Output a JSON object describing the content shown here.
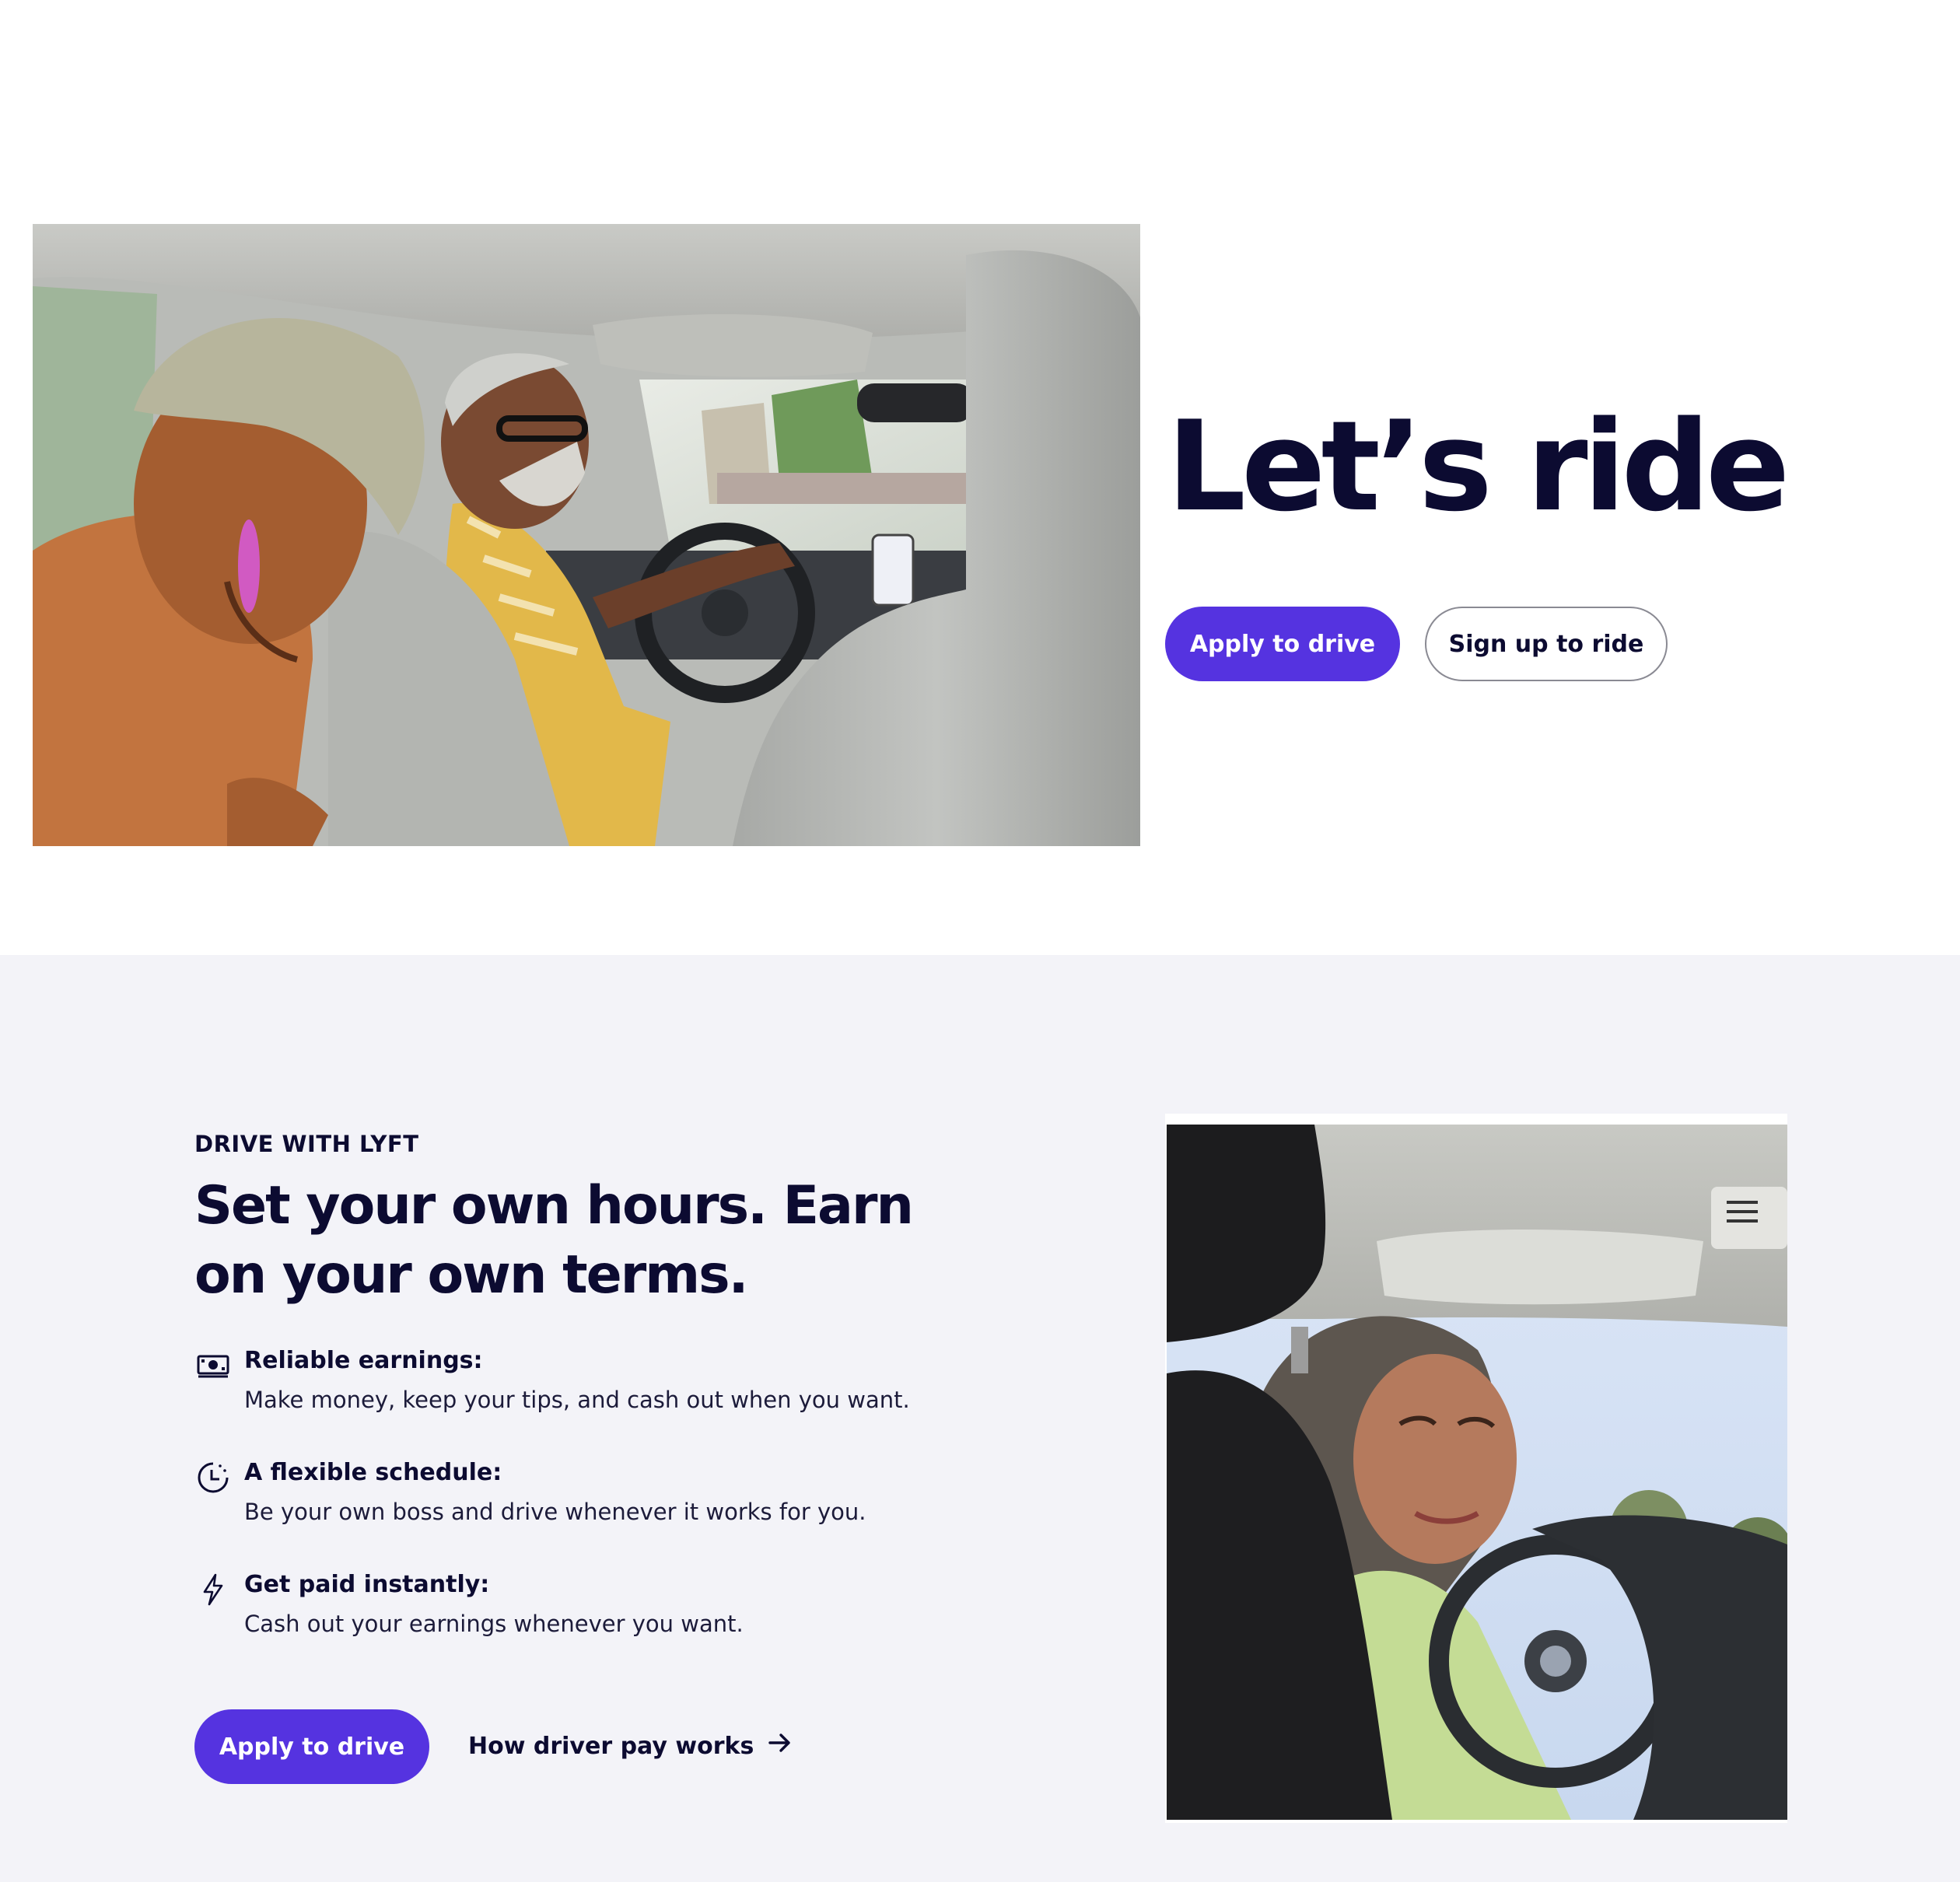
{
  "hero": {
    "title": "Let’s ride",
    "apply_label": "Apply to drive",
    "signup_label": "Sign up to ride",
    "photo_description": "passengers-in-car-photo"
  },
  "drive": {
    "eyebrow": "DRIVE WITH LYFT",
    "heading": "Set your own hours. Earn on your own terms.",
    "features": [
      {
        "icon": "cash-icon",
        "title": "Reliable earnings:",
        "description": "Make money, keep your tips, and cash out when you want."
      },
      {
        "icon": "clock-icon",
        "title": "A flexible schedule:",
        "description": "Be your own boss and drive whenever it works for you."
      },
      {
        "icon": "lightning-icon",
        "title": "Get paid instantly:",
        "description": "Cash out your earnings whenever you want."
      }
    ],
    "apply_label": "Apply to drive",
    "pay_link_label": "How driver pay works",
    "photo_description": "driver-portrait-photo"
  },
  "colors": {
    "brand_purple": "#5533e0",
    "ink": "#0c0b31",
    "section_bg": "#f3f3f8"
  }
}
